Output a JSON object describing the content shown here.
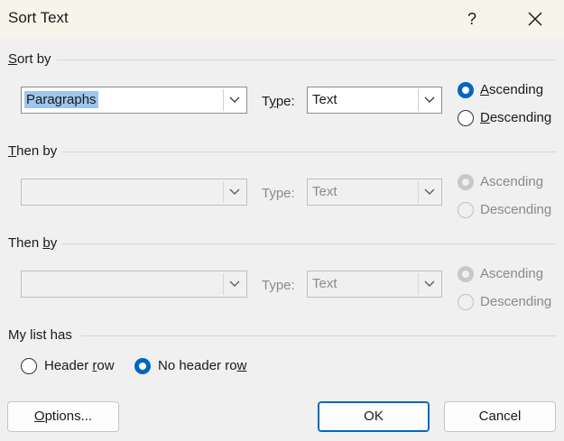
{
  "dialog": {
    "title": "Sort Text",
    "help_label": "?"
  },
  "sort_by": {
    "label_prefix": "",
    "label_key": "S",
    "label_rest": "ort by",
    "field_value": "Paragraphs",
    "type_label_pre": "T",
    "type_label_key": "y",
    "type_label_post": "pe:",
    "type_value": "Text",
    "ascending_pre": "",
    "ascending_key": "A",
    "ascending_post": "scending",
    "descending_pre": "",
    "descending_key": "D",
    "descending_post": "escending",
    "order": "ascending"
  },
  "then_by_1": {
    "label_key": "T",
    "label_rest": "hen by",
    "field_value": "",
    "type_label": "Type:",
    "type_value": "Text",
    "ascending": "Ascending",
    "descending": "Descending"
  },
  "then_by_2": {
    "label_pre": "Then ",
    "label_key": "b",
    "label_post": "y",
    "field_value": "",
    "type_label": "Type:",
    "type_value": "Text",
    "ascending": "Ascending",
    "descending": "Descending"
  },
  "my_list_has": {
    "label": "My list has",
    "header_row_pre": "Header ",
    "header_row_key": "r",
    "header_row_post": "ow",
    "no_header_row_pre": "No header ro",
    "no_header_row_key": "w",
    "no_header_row_post": "",
    "selected": "no_header_row"
  },
  "buttons": {
    "options_key": "O",
    "options_rest": "ptions...",
    "ok": "OK",
    "cancel": "Cancel"
  },
  "colors": {
    "accent": "#0067c0",
    "selection": "#9fc5ee",
    "titlebar": "#f7f5ea",
    "background": "#f0f0f0"
  }
}
